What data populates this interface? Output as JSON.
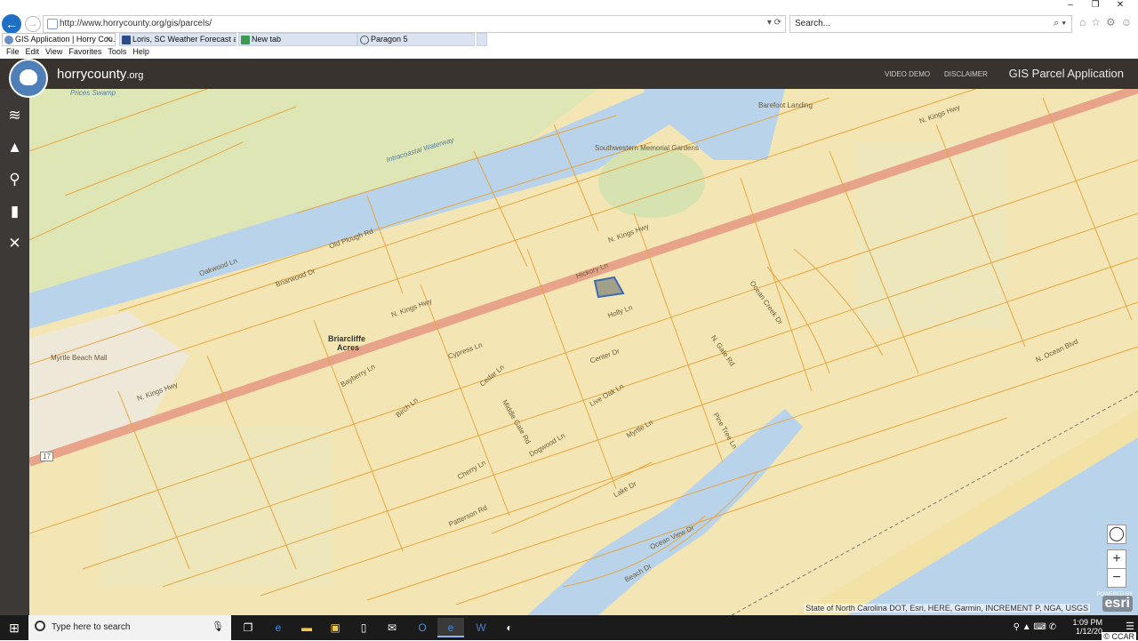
{
  "browser": {
    "url": "http://www.horrycounty.org/gis/parcels/",
    "search_placeholder": "Search...",
    "window_controls": [
      "–",
      "❐",
      "✕"
    ],
    "tabs": [
      {
        "label": "GIS Application | Horry Cou...",
        "active": true
      },
      {
        "label": "Loris, SC Weather Forecast and...",
        "active": false
      },
      {
        "label": "New tab",
        "active": false
      },
      {
        "label": "Paragon 5",
        "active": false
      }
    ],
    "menu": [
      "File",
      "Edit",
      "View",
      "Favorites",
      "Tools",
      "Help"
    ]
  },
  "app": {
    "logo_name": "horrycounty",
    "logo_tld": ".org",
    "links": [
      "VIDEO DEMO",
      "DISCLAIMER"
    ],
    "title": "GIS Parcel Application"
  },
  "sidebar_icons": [
    "layers-icon",
    "basemap-icon",
    "search-icon",
    "bookmark-icon",
    "tools-icon"
  ],
  "map": {
    "labels": {
      "prices_swamp": "Prices Swamp",
      "waterway": "Intracoastal Waterway",
      "kings_hwy_1": "N. Kings Hwy",
      "kings_hwy_2": "N. Kings Hwy",
      "kings_hwy_3": "N. Kings Hwy",
      "kings_hwy_4": "N. Kings Hwy",
      "briarcliffe": "Briarcliffe",
      "acres": "Acres",
      "old_pdu": "Old Plough Rd",
      "oakwood": "Oakwood Ln",
      "briarwood": "Briarwood Dr",
      "cypress": "Cypress Ln",
      "center_dr": "Center Dr",
      "cedar": "Cedar Ln",
      "birch": "Birch Ln",
      "cherry": "Cherry Ln",
      "dogwood": "Dogwood Ln",
      "live_oak": "Live Oak Ln",
      "myrtle": "Myrtle Ln",
      "lake_dr": "Lake Dr",
      "ocean_view": "Ocean View Dr",
      "middle_gate": "Middle Gate Rd",
      "patterson": "Patterson Rd",
      "beach_dr": "Beach Dr",
      "hickory": "Hickory Ln",
      "holly": "Holly Ln",
      "n_gate": "N. Gate Rd",
      "ocean_creek": "Ocean Creek Dr",
      "myrtle_mall": "Myrtle Beach Mall",
      "southwestern": "Southwestern Memorial Gardens",
      "barefoot": "Barefoot Landing",
      "n_ocean": "N. Ocean Blvd",
      "pinetree": "Pine Tree Ln",
      "kayberry": "Bayberry Ln"
    },
    "route_shield": "17",
    "zoom_in": "+",
    "zoom_out": "−",
    "attribution": "State of North Carolina DOT, Esri, HERE, Garmin, INCREMENT P, NGA, USGS",
    "esri": "esri",
    "powered_by": "POWERED BY"
  },
  "taskbar": {
    "search_placeholder": "Type here to search",
    "time": "1:09 PM",
    "date": "1/12/20",
    "ccar": "© CCAR"
  }
}
